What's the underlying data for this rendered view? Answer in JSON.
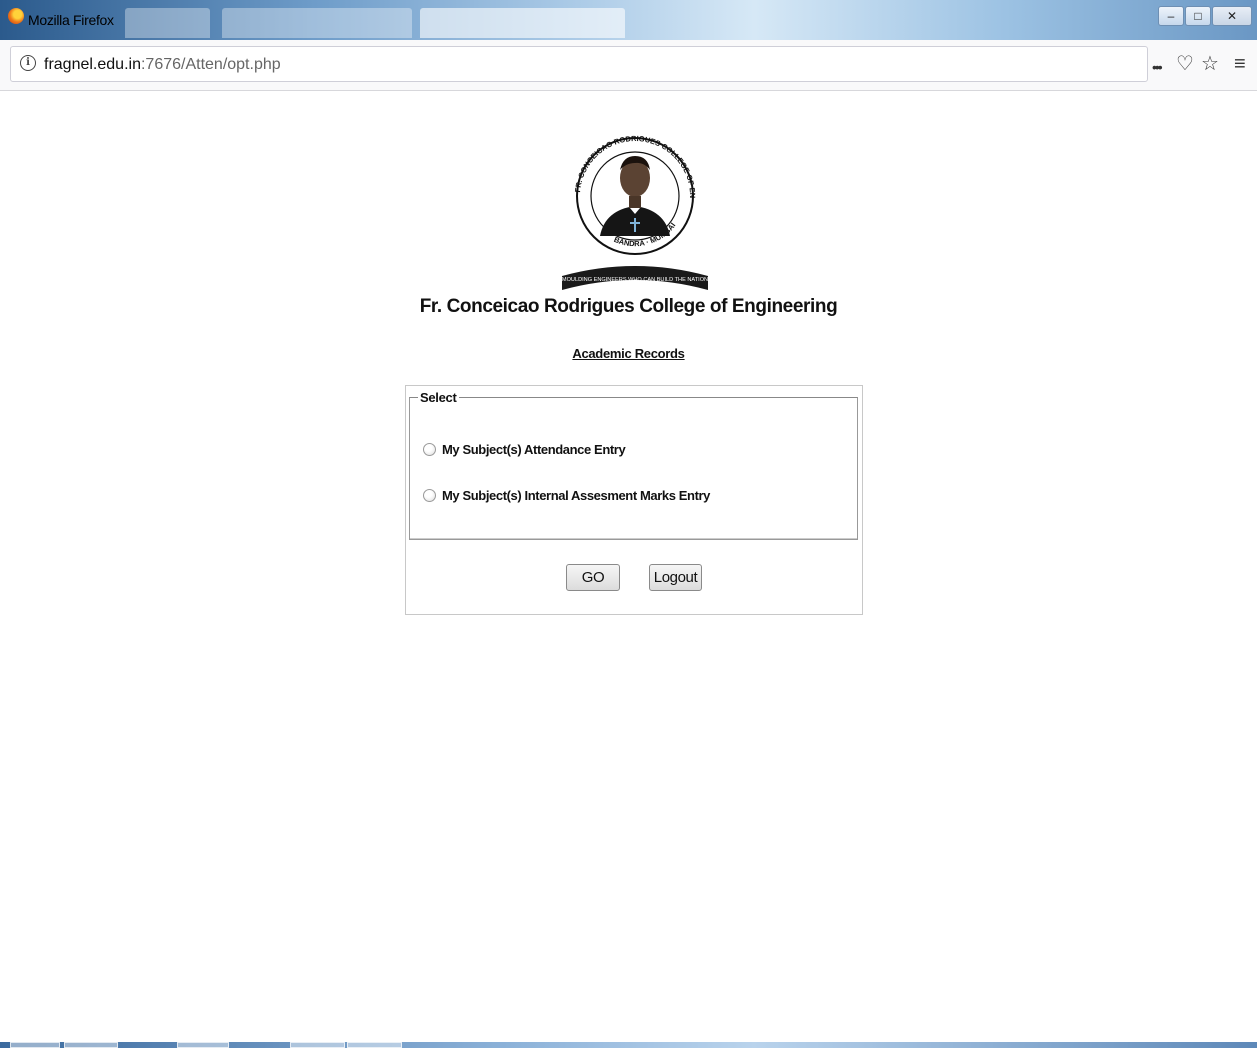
{
  "window": {
    "title": "Mozilla Firefox",
    "minimize_glyph": "–",
    "maximize_glyph": "□",
    "close_glyph": "✕"
  },
  "navbar": {
    "info_glyph": "i",
    "url_host": "fragnel.edu.in",
    "url_path": ":7676/Atten/opt.php",
    "more_glyph": "•••",
    "pocket_glyph": "♡",
    "star_glyph": "☆",
    "menu_glyph": "≡"
  },
  "page": {
    "college_name": "Fr. Conceicao Rodrigues College of Engineering",
    "records_link": "Academic Records",
    "logo": {
      "ring_text": "FR. CONCEICAO RODRIGUES COLLEGE OF ENGINEERING",
      "bottom_text": "BANDRA · MUMBAI",
      "motto": "MOULDING ENGINEERS WHO CAN BUILD THE NATION"
    },
    "fieldset_legend": "Select",
    "options": [
      {
        "label": "My Subject(s) Attendance Entry",
        "checked": false
      },
      {
        "label": "My Subject(s) Internal Assesment Marks Entry",
        "checked": false
      }
    ],
    "go_button": "GO",
    "logout_button": "Logout"
  },
  "colors": {
    "title_gradient_dark": "#2b5a8c",
    "title_gradient_light": "#d6e8f6",
    "logo_ribbon": "#1a1a1a"
  }
}
